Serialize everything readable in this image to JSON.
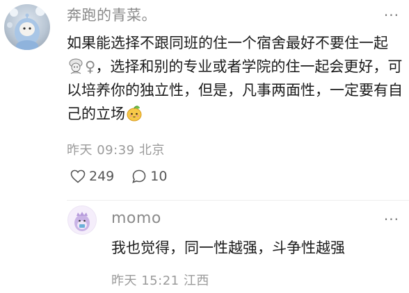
{
  "comment": {
    "username": "奔跑的青菜。",
    "text_before_emoji1": "如果能选择不跟同班的住一个宿舍最好不要住一起",
    "emoji1": "woman-with-turban-emoji",
    "text_after_emoji1": "，选择和别的专业或者学院的住一起会更好，可以培养你的独立性，但是，凡事两面性，一定要有自己的立场",
    "emoji2": "mango-face-emoji",
    "time": "昨天 09:39",
    "location": "北京",
    "likes": "249",
    "replies": "10",
    "more_icon": "more-dots-icon"
  },
  "reply": {
    "username": "momo",
    "text": "我也觉得，同一性越强，斗争性越强",
    "time": "昨天 15:21",
    "location": "江西",
    "more_icon": "more-dots-icon"
  },
  "colors": {
    "username": "#8a8a8a",
    "meta": "#9a9a9a",
    "text": "#1a1a1a"
  }
}
